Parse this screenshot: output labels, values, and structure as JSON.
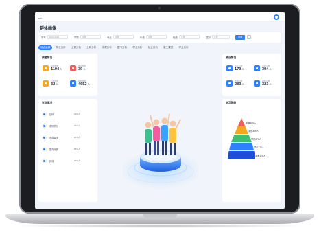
{
  "header": {
    "title": "群体画像"
  },
  "filters": [
    {
      "label": "学年",
      "value": "2023-2024"
    },
    {
      "label": "学院",
      "value": "全部"
    },
    {
      "label": "专业",
      "value": "全部"
    },
    {
      "label": "年级",
      "value": "全部"
    },
    {
      "label": "班级",
      "value": "全部"
    },
    {
      "label": "性别",
      "value": "全部"
    }
  ],
  "query_label": "查询",
  "tabs": [
    {
      "label": "综合画像",
      "active": true
    },
    {
      "label": "学业分析"
    },
    {
      "label": "上课分析"
    },
    {
      "label": "上网分析"
    },
    {
      "label": "消费分析"
    },
    {
      "label": "图书分析"
    },
    {
      "label": "学业分析"
    },
    {
      "label": "就业分析"
    },
    {
      "label": "第二课堂"
    },
    {
      "label": "学业分析"
    }
  ],
  "left_top_card": {
    "title": "预警情况",
    "more": "···",
    "stats": [
      {
        "label": "总预警数",
        "value": "1104",
        "unit": "人",
        "color": "#f5a623"
      },
      {
        "label": "学业预警",
        "value": "39",
        "unit": "人",
        "color": "#f25c5c"
      },
      {
        "label": "心理预警",
        "value": "32",
        "unit": "人",
        "color": "#f5a623"
      },
      {
        "label": "其他预警",
        "value": "4652",
        "unit": "人",
        "color": "#2f80ff"
      }
    ]
  },
  "left_bottom_card": {
    "title": "学业情况",
    "more": "···",
    "rows": [
      {
        "label": "挂科",
        "value": "30%人",
        "icon": "search-icon"
      },
      {
        "label": "重修学分",
        "value": "11%人",
        "icon": "book-icon"
      },
      {
        "label": "出国留学",
        "value": "20%人",
        "icon": "plane-icon"
      },
      {
        "label": "国内深造",
        "value": "15%人",
        "icon": "cap-icon"
      },
      {
        "label": "其他",
        "value": "10%人",
        "icon": "dot-icon"
      }
    ]
  },
  "right_top_card": {
    "title": "就业情况",
    "more": "···",
    "stats": [
      {
        "label": "就业人数",
        "value": "179",
        "unit": "人",
        "color": "#2f80ff"
      },
      {
        "label": "考研人数",
        "value": "304",
        "unit": "人",
        "color": "#2f80ff"
      },
      {
        "label": "出国人数",
        "value": "289",
        "unit": "人",
        "color": "#2f80ff"
      },
      {
        "label": "其他人数",
        "value": "323",
        "unit": "人",
        "color": "#2f80ff"
      }
    ]
  },
  "right_bottom_card": {
    "title": "学习等级",
    "pyramid": [
      {
        "label": "学霸404人",
        "color": "#f25c5c"
      },
      {
        "label": "学优300人",
        "color": "#f5a623"
      },
      {
        "label": "学良270人",
        "color": "#3fbf6f"
      },
      {
        "label": "学中170人",
        "color": "#2f80ff"
      },
      {
        "label": "学差171人",
        "color": "#1f4fd8"
      }
    ]
  },
  "colors": {
    "accent": "#2f80ff",
    "background": "#f1f4fa"
  }
}
